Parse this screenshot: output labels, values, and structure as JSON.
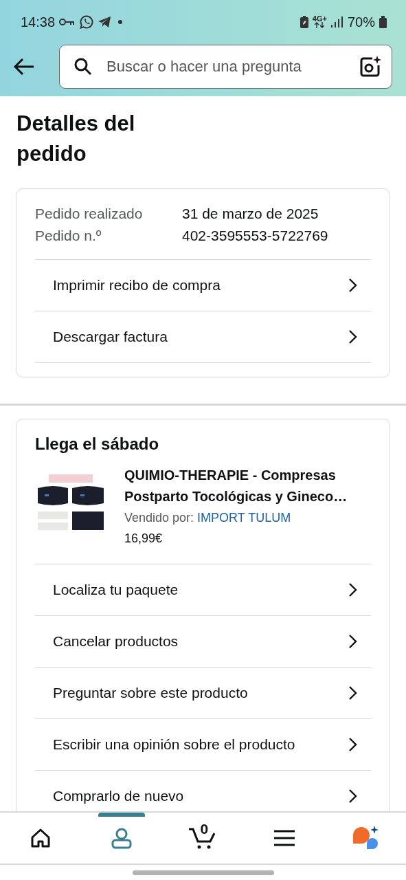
{
  "status_bar": {
    "time": "14:38",
    "network": "4G+",
    "battery": "70%"
  },
  "search": {
    "placeholder": "Buscar o hacer una pregunta"
  },
  "title": "Detalles del pedido",
  "order": {
    "details": [
      {
        "label": "Pedido realizado",
        "value": "31 de marzo de 2025"
      },
      {
        "label": "Pedido n.º",
        "value": "402-3595553-5722769"
      }
    ],
    "actions": [
      "Imprimir recibo de compra",
      "Descargar factura"
    ]
  },
  "shipment": {
    "heading": "Llega el sábado",
    "product": {
      "title": "QUIMIO-THERAPIE - Compresas Postparto Tocológicas y Gineco…",
      "seller_label": "Vendido por:",
      "seller": "IMPORT TULUM",
      "price": "16,99€"
    },
    "actions": [
      "Localiza tu paquete",
      "Cancelar productos",
      "Preguntar sobre este producto",
      "Escribir una opinión sobre el producto",
      "Comprarlo de nuevo"
    ]
  },
  "bottom_nav": [
    {
      "kind": "home",
      "selected": false
    },
    {
      "kind": "account",
      "selected": true
    },
    {
      "kind": "cart",
      "selected": false,
      "count": "0"
    },
    {
      "kind": "menu",
      "selected": false
    },
    {
      "kind": "assistant",
      "selected": false
    }
  ]
}
